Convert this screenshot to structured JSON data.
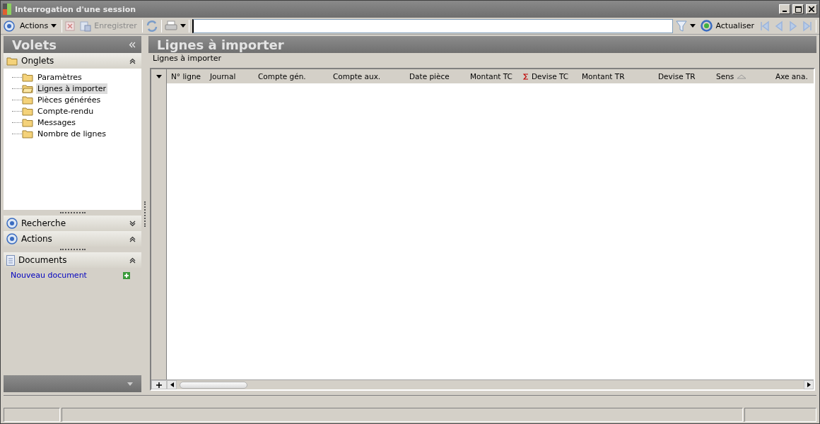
{
  "window": {
    "title": "Interrogation d'une session"
  },
  "toolbar": {
    "actions_menu": "Actions",
    "save": {
      "label": "Enregistrer",
      "disabled": true
    },
    "refresh": "Actualiser"
  },
  "sidebar": {
    "title": "Volets",
    "sections": [
      {
        "kind": "tree",
        "title": "Onglets",
        "expanded": true,
        "items": [
          {
            "label": "Paramètres",
            "selected": false
          },
          {
            "label": "Lignes à importer",
            "selected": true
          },
          {
            "label": "Pièces générées",
            "selected": false
          },
          {
            "label": "Compte-rendu",
            "selected": false
          },
          {
            "label": "Messages",
            "selected": false
          },
          {
            "label": "Nombre de lignes",
            "selected": false
          }
        ]
      },
      {
        "kind": "task",
        "title": "Recherche",
        "expanded": false
      },
      {
        "kind": "task",
        "title": "Actions",
        "expanded": true
      },
      {
        "kind": "documents",
        "title": "Documents",
        "expanded": true,
        "link": "Nouveau document"
      }
    ]
  },
  "main": {
    "title": "Lignes à importer",
    "group_label": "Lignes à importer",
    "table": {
      "columns": [
        {
          "label": "N° ligne",
          "sum": false,
          "sorted": false
        },
        {
          "label": "Journal",
          "sum": false,
          "sorted": false
        },
        {
          "label": "Compte gén.",
          "sum": false,
          "sorted": false
        },
        {
          "label": "Compte aux.",
          "sum": false,
          "sorted": false
        },
        {
          "label": "Date pièce",
          "sum": false,
          "sorted": false
        },
        {
          "label": "Montant TC",
          "sum": false,
          "sorted": false
        },
        {
          "label": "Devise TC",
          "sum": true,
          "sorted": false
        },
        {
          "label": "Montant TR",
          "sum": false,
          "sorted": false
        },
        {
          "label": "Devise TR",
          "sum": false,
          "sorted": false
        },
        {
          "label": "Sens",
          "sum": false,
          "sorted": true
        },
        {
          "label": "Axe ana.",
          "sum": false,
          "sorted": false
        }
      ]
    }
  }
}
